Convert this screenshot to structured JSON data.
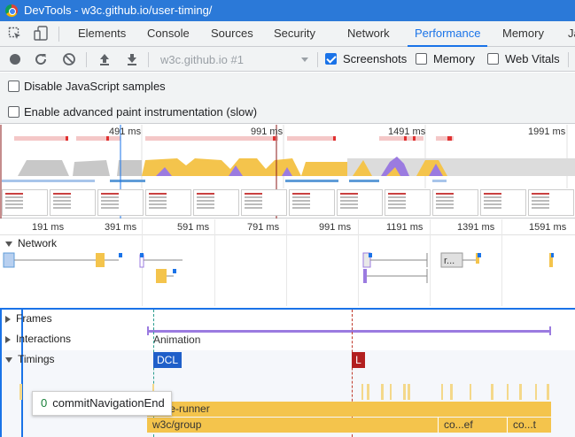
{
  "window": {
    "title": "DevTools - w3c.github.io/user-timing/"
  },
  "tabs": [
    {
      "label": "Elements",
      "active": false
    },
    {
      "label": "Console",
      "active": false
    },
    {
      "label": "Sources",
      "active": false
    },
    {
      "label": "Security",
      "active": false
    },
    {
      "label": "Network",
      "active": false
    },
    {
      "label": "Performance",
      "active": true
    },
    {
      "label": "Memory",
      "active": false
    },
    {
      "label": "Ja",
      "active": false
    }
  ],
  "toolbar": {
    "recording_select": "w3c.github.io #1",
    "screenshots_label": "Screenshots",
    "screenshots_checked": true,
    "memory_label": "Memory",
    "memory_checked": false,
    "web_vitals_label": "Web Vitals",
    "web_vitals_checked": false
  },
  "settings": {
    "disable_js_samples": "Disable JavaScript samples",
    "enable_paint": "Enable advanced paint instrumentation (slow)"
  },
  "overview": {
    "ticks": [
      "491 ms",
      "991 ms",
      "1491 ms",
      "1991 ms"
    ]
  },
  "ruler": {
    "ticks": [
      "191 ms",
      "391 ms",
      "591 ms",
      "791 ms",
      "991 ms",
      "1191 ms",
      "1391 ms",
      "1591 ms"
    ]
  },
  "tracks": {
    "network": "Network",
    "frames": "Frames",
    "interactions": "Interactions",
    "timings": "Timings",
    "animation": "Animation",
    "network_item": "r..."
  },
  "markers": {
    "dcl": "DCL",
    "load": "L"
  },
  "bars": {
    "base_runner": "base-runner",
    "w3c_group": "w3c/group",
    "coef": "co...ef",
    "cot": "co...t"
  },
  "tooltip": {
    "count": "0",
    "label": "commitNavigationEnd"
  },
  "colors": {
    "accent": "#1a73e8",
    "titlebar": "#2b79d8",
    "scripting": "#f4c44c",
    "rendering": "#9b7be0",
    "dcl": "#1f5fc9",
    "load": "#b21f1f"
  }
}
